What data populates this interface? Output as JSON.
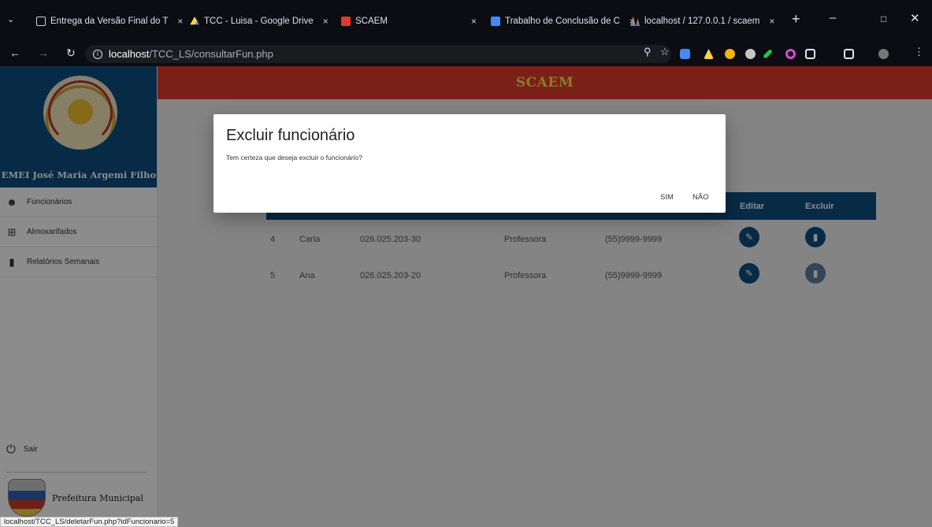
{
  "browser": {
    "tabs": [
      {
        "title": "Entrega da Versão Final do T",
        "icon": "doc-icon"
      },
      {
        "title": "TCC - Luisa - Google Drive",
        "icon": "drive-icon"
      },
      {
        "title": "SCAEM",
        "icon": "scaem-icon"
      },
      {
        "title": "Trabalho de Conclusão de C",
        "icon": "docs-icon"
      },
      {
        "title": "localhost / 127.0.0.1 / scaem",
        "icon": "phpmyadmin-icon"
      }
    ],
    "close_glyph": "×",
    "new_tab": "+",
    "url_host": "localhost",
    "url_path": "/TCC_LS/consultarFun.php",
    "status_url": "localhost/TCC_LS/deletarFun.php?idFuncionario=5"
  },
  "sidebar": {
    "school_name": "EMEI José Maria Argemi Filho",
    "items": [
      {
        "label": "Funcionários",
        "icon": "person-icon"
      },
      {
        "label": "Almoxarifados",
        "icon": "grid-icon"
      },
      {
        "label": "Relatórios Semanais",
        "icon": "document-icon"
      }
    ],
    "exit_label": "Sair",
    "footer": "Prefeitura Municipal"
  },
  "header": {
    "title": "SCAEM"
  },
  "table": {
    "visible_headers": {
      "edit": "Editar",
      "delete": "Excluir"
    },
    "rows": [
      {
        "id": "4",
        "name": "Carla",
        "cpf": "026.025.203-30",
        "role": "Professora",
        "phone": "(55)9999-9999"
      },
      {
        "id": "5",
        "name": "Ana",
        "cpf": "026.025.203-20",
        "role": "Professora",
        "phone": "(55)9999-9999"
      }
    ]
  },
  "dialog": {
    "title": "Excluir funcionário",
    "message": "Tem certeza que deseja excluir o funcionário?",
    "confirm": "SIM",
    "cancel": "NÃO"
  },
  "colors": {
    "primary_blue": "#0d4d80",
    "header_red": "#e03a2f",
    "header_text_yellow": "#f7e24b"
  }
}
